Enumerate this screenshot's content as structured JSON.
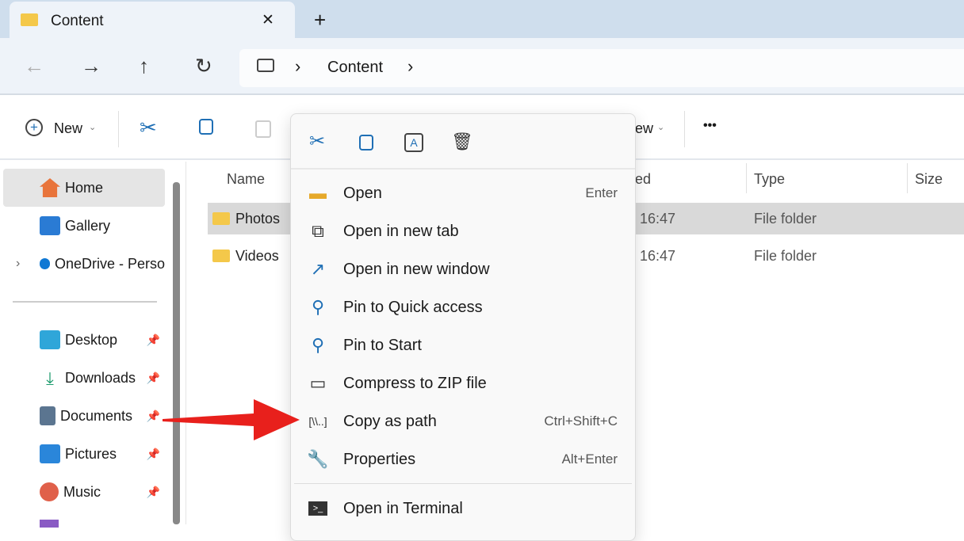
{
  "tab": {
    "title": "Content",
    "close": "✕",
    "new_tab": "+"
  },
  "nav": {
    "back": "←",
    "forward": "→",
    "up": "↑",
    "refresh": "↻",
    "breadcrumb": [
      "Content"
    ],
    "chevron": "›"
  },
  "toolbar": {
    "new_label": "New",
    "view_label": "ew",
    "more": "•••"
  },
  "sidebar": {
    "items": [
      {
        "label": "Home",
        "selected": true
      },
      {
        "label": "Gallery"
      },
      {
        "label": "OneDrive - Perso"
      }
    ],
    "pinned": [
      {
        "label": "Desktop"
      },
      {
        "label": "Downloads"
      },
      {
        "label": "Documents"
      },
      {
        "label": "Pictures"
      },
      {
        "label": "Music"
      }
    ]
  },
  "columns": {
    "name": "Name",
    "modified": "ed",
    "type": "Type",
    "size": "Size"
  },
  "files": [
    {
      "name": "Photos",
      "modified": "16:47",
      "type": "File folder",
      "selected": true
    },
    {
      "name": "Videos",
      "modified": "16:47",
      "type": "File folder"
    }
  ],
  "menu": {
    "items": [
      {
        "label": "Open",
        "shortcut": "Enter",
        "icon": "folder-open-icon"
      },
      {
        "label": "Open in new tab",
        "icon": "new-tab-icon"
      },
      {
        "label": "Open in new window",
        "icon": "new-window-icon"
      },
      {
        "label": "Pin to Quick access",
        "icon": "pin-icon"
      },
      {
        "label": "Pin to Start",
        "icon": "pin-icon"
      },
      {
        "label": "Compress to ZIP file",
        "icon": "zip-icon"
      },
      {
        "label": "Copy as path",
        "shortcut": "Ctrl+Shift+C",
        "icon": "copy-path-icon"
      },
      {
        "label": "Properties",
        "shortcut": "Alt+Enter",
        "icon": "wrench-icon"
      },
      {
        "label": "Open in Terminal",
        "icon": "terminal-icon"
      }
    ]
  },
  "colors": {
    "accent": "#1f6fb5",
    "arrow": "#e8201c",
    "selection": "#d9d9d9"
  }
}
